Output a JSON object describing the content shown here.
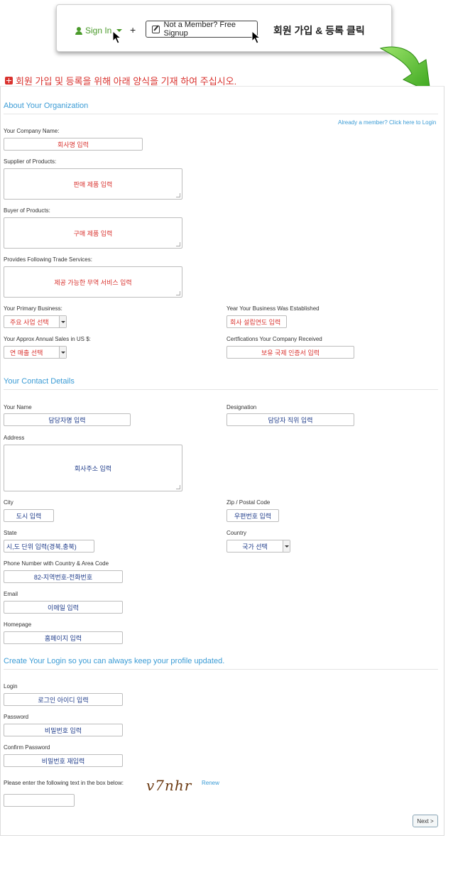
{
  "callout": {
    "signin_label": "Sign In",
    "plus": "+",
    "signup_label": "Not a Member? Free Signup",
    "instruction": "회원 가입 & 등록 클릭"
  },
  "headline": "회원 가입 및 등록을 위해 아래 양식을 기재 하여 주십시오.",
  "organization": {
    "title": "About Your Organization",
    "login_link": "Already a member? Click here to Login",
    "company_name": {
      "label": "Your Company Name:",
      "value": "회사명 입력"
    },
    "supplier": {
      "label": "Supplier of Products:",
      "value": "판매 제품 입력"
    },
    "buyer": {
      "label": "Buyer of Products:",
      "value": "구매 제품 입력"
    },
    "trade_services": {
      "label": "Provides Following Trade Services:",
      "value": "제공 가능한 무역 서비스 입력"
    },
    "primary_business": {
      "label": "Your Primary Business:",
      "value": "주요 사업 선택"
    },
    "year_established": {
      "label": "Year Your Business Was Established",
      "value": "회사 설립연도 입력"
    },
    "annual_sales": {
      "label": "Your Approx Annual Sales in US $:",
      "value": "연 매출 선택"
    },
    "certifications": {
      "label": "Certfications Your Company Received",
      "value": "보유 국제 인증서 입력"
    }
  },
  "contact": {
    "title": "Your Contact Details",
    "name": {
      "label": "Your Name",
      "value": "담당자명 입력"
    },
    "designation": {
      "label": "Designation",
      "value": "담당자 직위 입력"
    },
    "address": {
      "label": "Address",
      "value": "회사주소 입력"
    },
    "city": {
      "label": "City",
      "value": "도시 입력"
    },
    "zip": {
      "label": "Zip / Postal Code",
      "value": "우편번호 입력"
    },
    "state": {
      "label": "State",
      "value": "시,도 단위 입력(경북,충북)"
    },
    "country": {
      "label": "Country",
      "value": "국가 선택"
    },
    "phone": {
      "label": "Phone Number with Country & Area Code",
      "value": "82-지역번호-전화번호"
    },
    "email": {
      "label": "Email",
      "value": "이메일 입력"
    },
    "homepage": {
      "label": "Homepage",
      "value": "홈페이지 입력"
    }
  },
  "login": {
    "title": "Create Your Login so you can always keep your profile updated.",
    "login": {
      "label": "Login",
      "value": "로그인 아이디 입력"
    },
    "password": {
      "label": "Password",
      "value": "비밀번호 입력"
    },
    "confirm": {
      "label": "Confirm Password",
      "value": "비밀번호 재입력"
    },
    "captcha_label": "Please enter the following text in the box below:",
    "captcha_text": "v7nhr",
    "renew": "Renew",
    "captcha_input": ""
  },
  "next_label": "Next >"
}
